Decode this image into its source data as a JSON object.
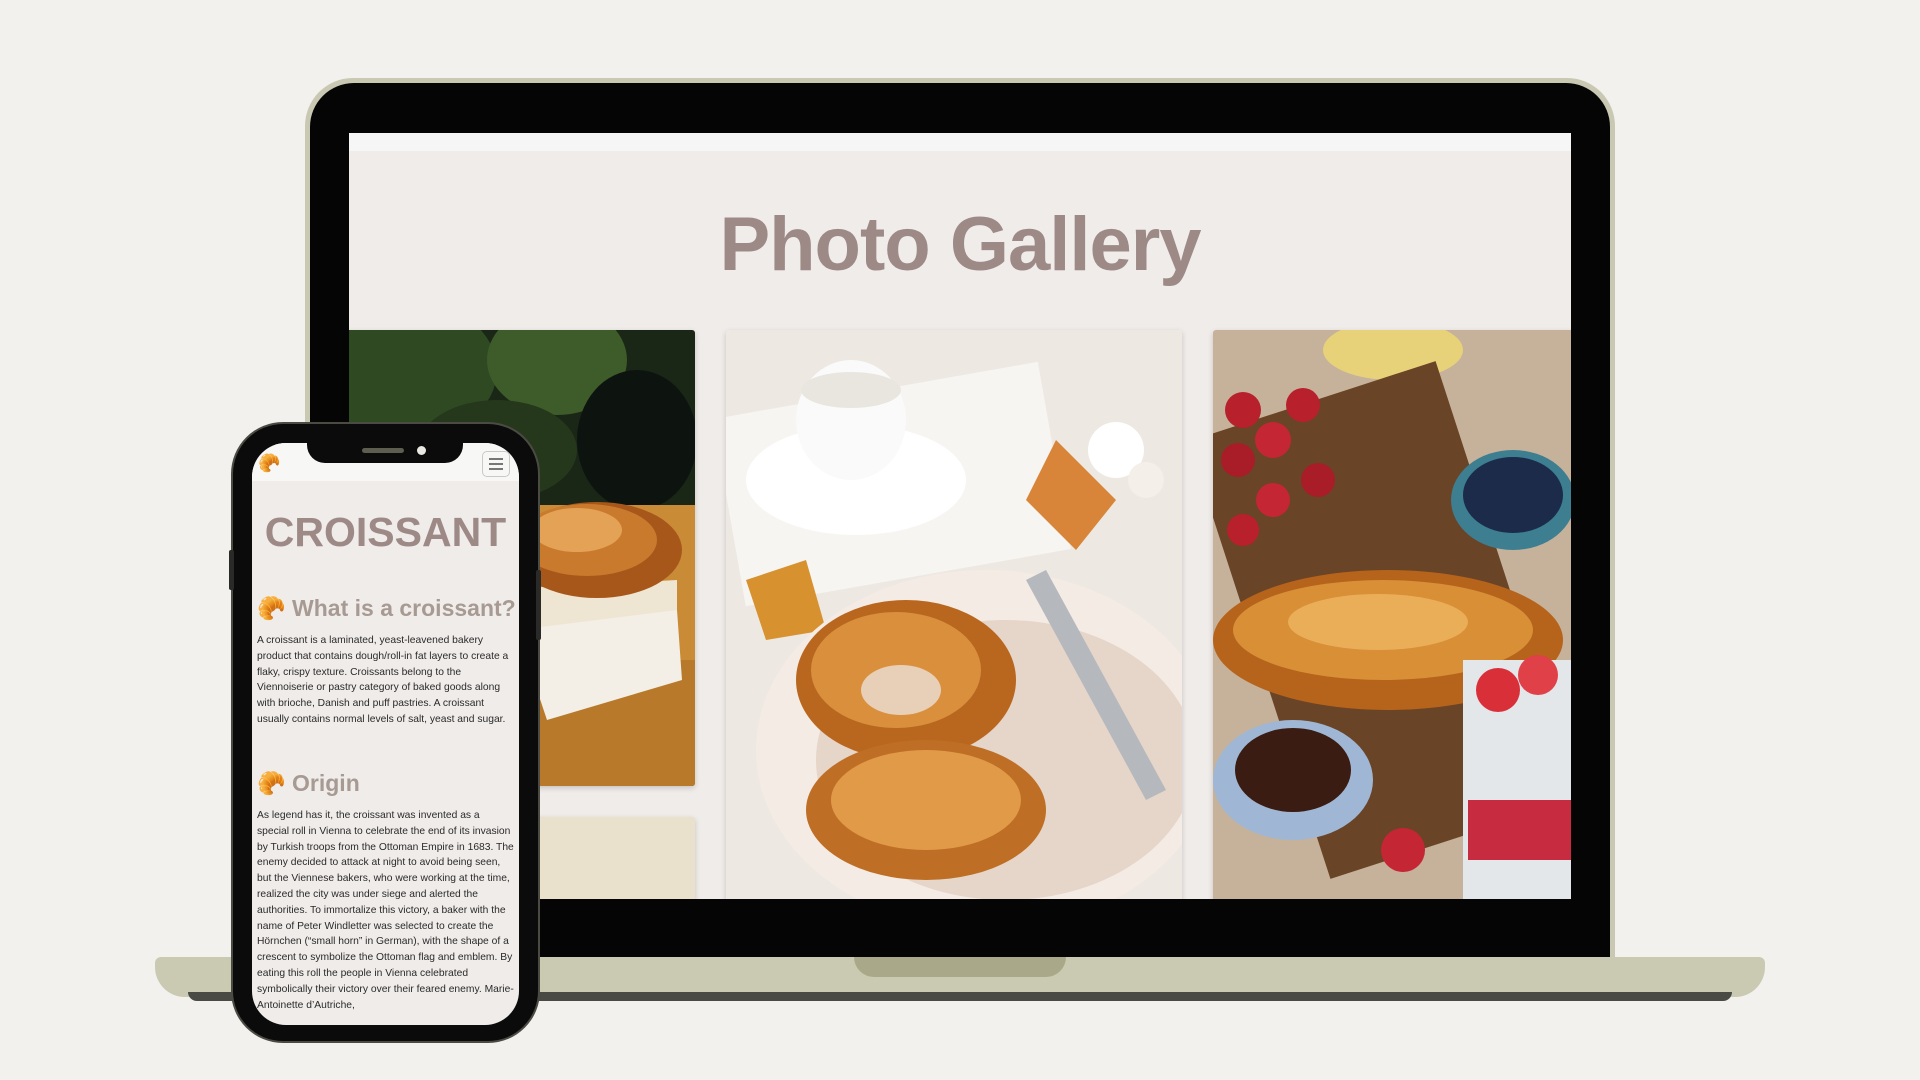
{
  "laptop": {
    "gallery_title": "Photo Gallery",
    "photos": [
      {
        "name": "croissant-on-board-photo"
      },
      {
        "name": "croissants-on-plate-photo"
      },
      {
        "name": "croissant-with-berries-photo"
      },
      {
        "name": "partial-photo"
      }
    ]
  },
  "phone": {
    "logo_icon": "croissant-icon",
    "logo_glyph": "🥐",
    "menu_icon": "hamburger-menu-icon",
    "page_title": "CROISSANT",
    "sections": [
      {
        "icon": "🥐",
        "heading": "What is a croissant?",
        "body": "A croissant is a laminated, yeast-leavened bakery product that contains dough/roll-in fat layers to create a flaky, crispy texture. Croissants belong to the Viennoiserie or pastry category of baked goods along with brioche, Danish and puff pastries. A croissant usually contains normal levels of salt, yeast and sugar."
      },
      {
        "icon": "🥐",
        "heading": "Origin",
        "body": "As legend has it, the croissant was invented as a special roll in Vienna to celebrate the end of its invasion by Turkish troops from the Ottoman Empire in 1683. The enemy decided to attack at night to avoid being seen, but the Viennese bakers, who were working at the time, realized the city was under siege and alerted the authorities. To immortalize this victory, a baker with the name of Peter Windletter was selected to create the Hörnchen (“small horn” in German), with the shape of a crescent to symbolize the Ottoman flag and emblem. By eating this roll the people in Vienna celebrated symbolically their victory over their feared enemy. Marie-Antoinette d’Autriche,"
      }
    ]
  },
  "colors": {
    "background": "#f2f1ee",
    "device_frame": "#c9c8b2",
    "title_color": "#9d8a87",
    "page_background": "#f0ecea"
  }
}
